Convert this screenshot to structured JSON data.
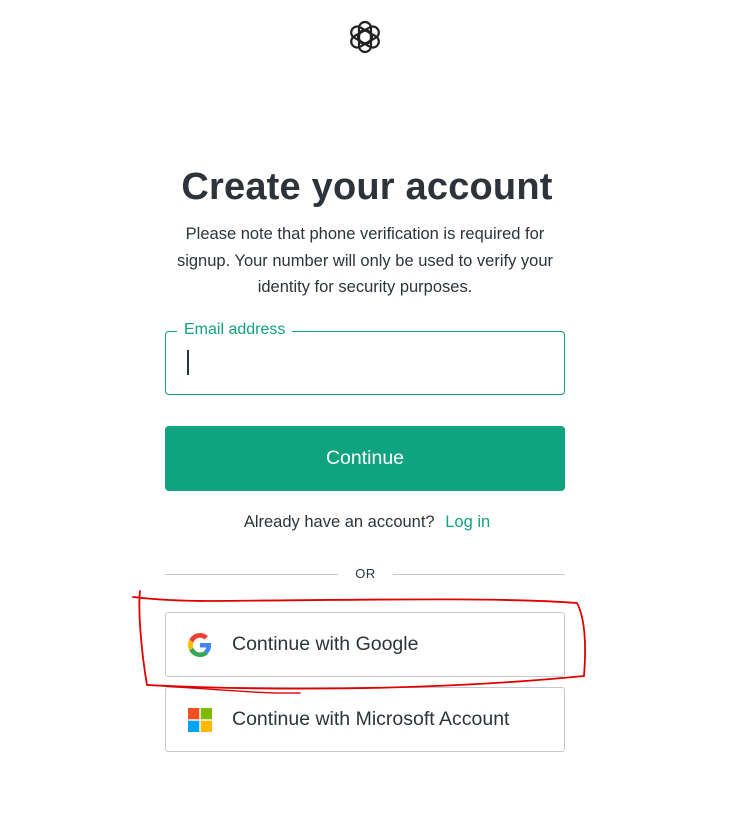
{
  "brand": {
    "logo_icon": "openai-logo-icon",
    "accent_color": "#10a37f",
    "text_color": "#2d333a"
  },
  "heading": {
    "title": "Create your account",
    "note": "Please note that phone verification is required for signup. Your number will only be used to verify your identity for security purposes."
  },
  "email": {
    "label": "Email address",
    "value": ""
  },
  "actions": {
    "continue_label": "Continue",
    "login_prompt": "Already have an account?",
    "login_link": "Log in",
    "divider": "OR"
  },
  "social": {
    "google_label": "Continue with Google",
    "google_icon": "google-icon",
    "microsoft_label": "Continue with Microsoft Account",
    "microsoft_icon": "microsoft-icon"
  },
  "annotation": {
    "color": "#e00000"
  }
}
